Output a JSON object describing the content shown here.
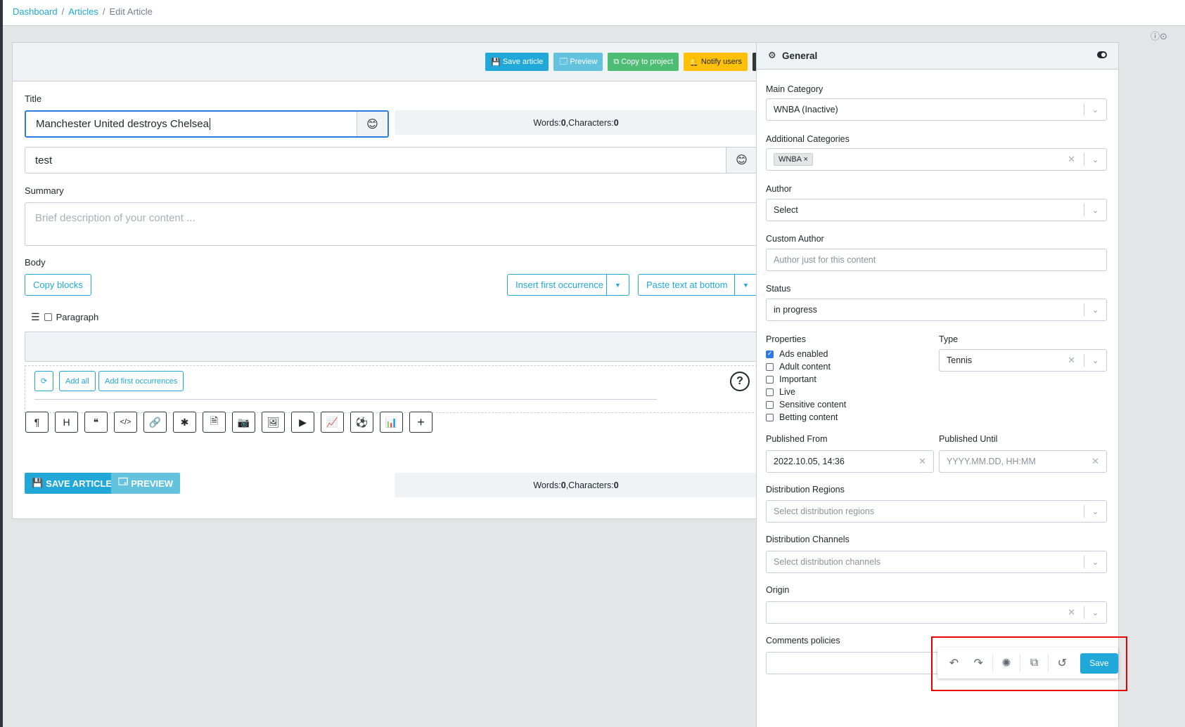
{
  "breadcrumb": {
    "item1": "Dashboard",
    "item2": "Articles",
    "item3": "Edit Article",
    "sep": "/"
  },
  "header_buttons": {
    "save": "Save article",
    "preview": "Preview",
    "copy": "Copy to project",
    "notify": "Notify users"
  },
  "title_section": {
    "label": "Title",
    "value": "Manchester United destroys Chelsea",
    "counter_words_label": "Words: ",
    "counter_words": "0",
    "counter_chars_label": ",Characters: ",
    "counter_chars": "0"
  },
  "subtitle_value": "test",
  "summary": {
    "label": "Summary",
    "placeholder": "Brief description of your content ..."
  },
  "body": {
    "label": "Body",
    "copy_blocks": "Copy blocks",
    "insert_first": "Insert first occurrence",
    "paste_bottom": "Paste text at bottom",
    "block_type": "Paragraph",
    "add_all": "Add all",
    "add_first": "Add first occurrences"
  },
  "toolbar_icons": [
    "paragraph-icon",
    "heading-icon",
    "quote-icon",
    "code-icon",
    "link-icon",
    "asterisk-icon",
    "document-icon",
    "camera-icon",
    "image-icon",
    "video-icon",
    "chart-line-icon",
    "football-icon",
    "chart-bar-icon",
    "plus-icon"
  ],
  "toolbar_glyphs": [
    "¶",
    "H",
    "❝",
    "</>",
    "🔗",
    "✱",
    "🗎",
    "📷",
    "🖼",
    "▶",
    "📈",
    "⚽",
    "📊",
    "+"
  ],
  "footer": {
    "save": "SAVE ARTICLE",
    "preview": "PREVIEW",
    "words_label": "Words: ",
    "words": "0",
    "chars_label": ",Characters: ",
    "chars": "0"
  },
  "sidebar": {
    "title": "General",
    "main_category": {
      "label": "Main Category",
      "value": "WNBA (Inactive)"
    },
    "additional_categories": {
      "label": "Additional Categories",
      "tag": "WNBA"
    },
    "author": {
      "label": "Author",
      "value": "Select"
    },
    "custom_author": {
      "label": "Custom Author",
      "placeholder": "Author just for this content"
    },
    "status": {
      "label": "Status",
      "value": "in progress"
    },
    "properties": {
      "label": "Properties",
      "items": [
        "Ads enabled",
        "Adult content",
        "Important",
        "Live",
        "Sensitive content",
        "Betting content"
      ]
    },
    "type": {
      "label": "Type",
      "value": "Tennis"
    },
    "published_from": {
      "label": "Published From",
      "value": "2022.10.05, 14:36"
    },
    "published_until": {
      "label": "Published Until",
      "placeholder": "YYYY.MM.DD, HH:MM"
    },
    "distribution_regions": {
      "label": "Distribution Regions",
      "placeholder": "Select distribution regions"
    },
    "distribution_channels": {
      "label": "Distribution Channels",
      "placeholder": "Select distribution channels"
    },
    "origin": {
      "label": "Origin"
    },
    "comments_policies": {
      "label": "Comments policies"
    }
  },
  "float_bar": {
    "save": "Save"
  },
  "colors": {
    "primary": "#20a8d8",
    "success": "#4dbd74",
    "warning": "#ffc107",
    "dark": "#2f353a",
    "highlight": "#e60000"
  }
}
